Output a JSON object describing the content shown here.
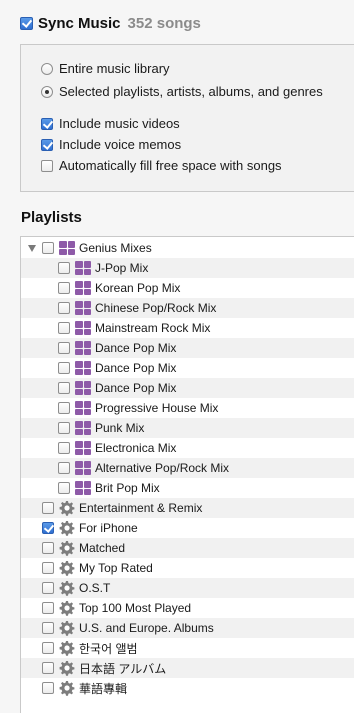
{
  "header": {
    "title": "Sync Music",
    "count": "352 songs",
    "checked": true
  },
  "options": {
    "entire_library": "Entire music library",
    "selected": "Selected playlists, artists, albums, and genres",
    "include_videos": "Include music videos",
    "include_memos": "Include voice memos",
    "autofill": "Automatically fill free space with songs"
  },
  "playlists_heading": "Playlists",
  "playlists": {
    "genius_root": {
      "label": "Genius Mixes",
      "checked": false
    },
    "genius_children": [
      {
        "label": "J-Pop Mix",
        "checked": false
      },
      {
        "label": "Korean Pop Mix",
        "checked": false
      },
      {
        "label": "Chinese Pop/Rock Mix",
        "checked": false
      },
      {
        "label": "Mainstream Rock Mix",
        "checked": false
      },
      {
        "label": "Dance Pop Mix",
        "checked": false
      },
      {
        "label": "Dance Pop Mix",
        "checked": false
      },
      {
        "label": "Dance Pop Mix",
        "checked": false
      },
      {
        "label": "Progressive House Mix",
        "checked": false
      },
      {
        "label": "Punk Mix",
        "checked": false
      },
      {
        "label": "Electronica Mix",
        "checked": false
      },
      {
        "label": "Alternative Pop/Rock Mix",
        "checked": false
      },
      {
        "label": "Brit Pop Mix",
        "checked": false
      }
    ],
    "smart": [
      {
        "label": "Entertainment & Remix",
        "checked": false
      },
      {
        "label": "For iPhone",
        "checked": true
      },
      {
        "label": "Matched",
        "checked": false
      },
      {
        "label": "My Top Rated",
        "checked": false
      },
      {
        "label": "O.S.T",
        "checked": false
      },
      {
        "label": "Top 100 Most Played",
        "checked": false
      },
      {
        "label": "U.S. and Europe. Albums",
        "checked": false
      },
      {
        "label": "한국어 앨범",
        "checked": false
      },
      {
        "label": "日本語 アルバム",
        "checked": false
      },
      {
        "label": "華語專輯",
        "checked": false
      }
    ]
  },
  "colors": {
    "genius_icon": "#8e5aa8",
    "checkbox_checked": "#2f6fd1",
    "count_gray": "#8b8b8b"
  }
}
